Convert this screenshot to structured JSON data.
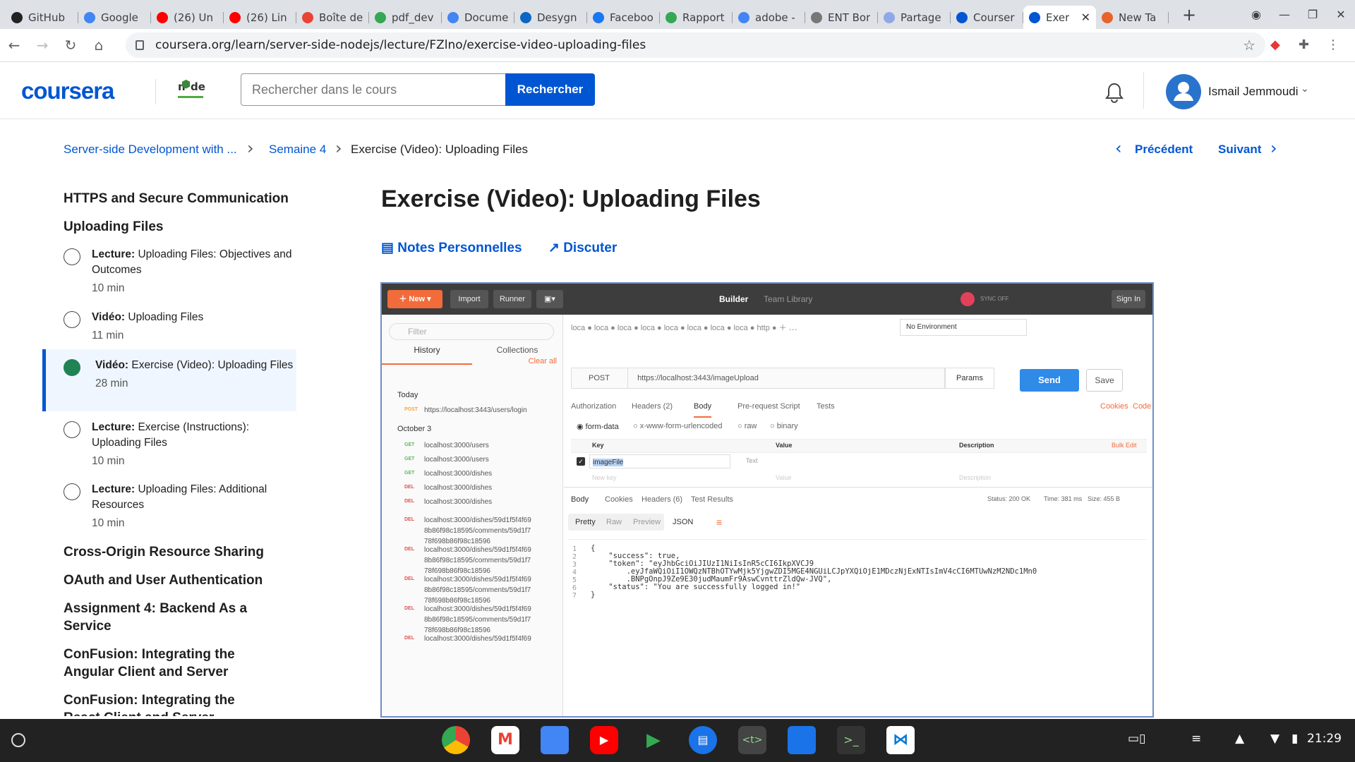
{
  "tabs": [
    {
      "label": "GitHub",
      "color": "#222"
    },
    {
      "label": "Google",
      "color": "#4285f4"
    },
    {
      "label": "(26) Un",
      "color": "#ff0000"
    },
    {
      "label": "(26) Lin",
      "color": "#ff0000"
    },
    {
      "label": "Boîte de",
      "color": "#ea4335"
    },
    {
      "label": "pdf_dev",
      "color": "#34a853"
    },
    {
      "label": "Docume",
      "color": "#4285f4"
    },
    {
      "label": "Desygn",
      "color": "#0a66c2"
    },
    {
      "label": "Faceboo",
      "color": "#1877f2"
    },
    {
      "label": "Rapport",
      "color": "#34a853"
    },
    {
      "label": "adobe -",
      "color": "#4285f4"
    },
    {
      "label": "ENT Bor",
      "color": "#777"
    },
    {
      "label": "Partage",
      "color": "#8fa8e8"
    },
    {
      "label": "Courser",
      "color": "#0056d2"
    },
    {
      "label": "Exer",
      "color": "#0056d2",
      "active": true
    },
    {
      "label": "New Ta",
      "color": "#e8622a"
    }
  ],
  "url": "coursera.org/learn/server-side-nodejs/lecture/FZlno/exercise-video-uploading-files",
  "header": {
    "logo": "coursera",
    "search_placeholder": "Rechercher dans le cours",
    "search_button": "Rechercher",
    "user_name": "Ismail Jemmoudi"
  },
  "breadcrumb": {
    "course": "Server-side Development with ...",
    "week": "Semaine 4",
    "current": "Exercise (Video): Uploading Files",
    "prev": "Précédent",
    "next": "Suivant"
  },
  "sidebar": {
    "sections_top": [
      "HTTPS and Secure Communication",
      "Uploading Files"
    ],
    "items": [
      {
        "type": "Lecture:",
        "title": "Uploading Files: Objectives and Outcomes",
        "dur": "10 min"
      },
      {
        "type": "Vidéo:",
        "title": "Uploading Files",
        "dur": "11 min"
      },
      {
        "type": "Vidéo:",
        "title": "Exercise (Video): Uploading Files",
        "dur": "28 min"
      },
      {
        "type": "Lecture:",
        "title": "Exercise (Instructions): Uploading Files",
        "dur": "10 min"
      },
      {
        "type": "Lecture:",
        "title": "Uploading Files: Additional Resources",
        "dur": "10 min"
      }
    ],
    "sections_bottom": [
      "Cross-Origin Resource Sharing",
      "OAuth and User Authentication",
      "Assignment 4: Backend As a Service",
      "ConFusion: Integrating the Angular Client and Server",
      "ConFusion: Integrating the React Client and Server"
    ]
  },
  "main": {
    "title": "Exercise (Video): Uploading Files",
    "notes": "Notes Personnelles",
    "discuss": "Discuter"
  },
  "video": {
    "buttons": {
      "new": "New",
      "import": "Import",
      "runner": "Runner",
      "builder": "Builder",
      "team": "Team Library",
      "sync": "SYNC OFF",
      "signin": "Sign In"
    },
    "filter": "Filter",
    "history": "History",
    "collections": "Collections",
    "clear": "Clear all",
    "today": "Today",
    "oct": "October 3",
    "requests": [
      {
        "m": "POST",
        "u": "https://localhost:3443/users/login"
      },
      {
        "m": "GET",
        "u": "localhost:3000/users"
      },
      {
        "m": "GET",
        "u": "localhost:3000/users"
      },
      {
        "m": "GET",
        "u": "localhost:3000/dishes"
      },
      {
        "m": "DEL",
        "u": "localhost:3000/dishes"
      },
      {
        "m": "DEL",
        "u": "localhost:3000/dishes"
      },
      {
        "m": "DEL",
        "u": "localhost:3000/dishes/59d1f5f4f69 8b86f98c18595/comments/59d1f7 78f698b86f98c18596"
      },
      {
        "m": "DEL",
        "u": "localhost:3000/dishes/59d1f5f4f69 8b86f98c18595/comments/59d1f7 78f698b86f98c18596"
      },
      {
        "m": "DEL",
        "u": "localhost:3000/dishes/59d1f5f4f69 8b86f98c18595/comments/59d1f7 78f698b86f98c18596"
      },
      {
        "m": "DEL",
        "u": "localhost:3000/dishes/59d1f5f4f69 8b86f98c18595/comments/59d1f7 78f698b86f98c18596"
      },
      {
        "m": "DEL",
        "u": "localhost:3000/dishes/59d1f5f4f69"
      }
    ],
    "env": "No Environment",
    "method": "POST",
    "req_url": "https://localhost:3443/imageUpload",
    "params": "Params",
    "send": "Send",
    "save": "Save",
    "req_tabs": [
      "Authorization",
      "Headers (2)",
      "Body",
      "Pre-request Script",
      "Tests"
    ],
    "cookies": "Cookies",
    "code": "Code",
    "body_types": [
      "form-data",
      "x-www-form-urlencoded",
      "raw",
      "binary"
    ],
    "kv": {
      "key": "Key",
      "value": "Value",
      "desc": "Description",
      "bulk": "Bulk Edit",
      "row_key": "imageFile",
      "row_type": "Text",
      "new_key": "New key",
      "new_value": "Value",
      "new_desc": "Description"
    },
    "resp_tabs": [
      "Body",
      "Cookies",
      "Headers (6)",
      "Test Results"
    ],
    "status": "Status: 200 OK",
    "time": "Time: 381 ms",
    "size": "Size: 455 B",
    "views": [
      "Pretty",
      "Raw",
      "Preview",
      "JSON"
    ],
    "json_lines": [
      "{",
      "    \"success\": true,",
      "    \"token\": \"eyJhbGciOiJIUzI1NiIsInR5cCI6IkpXVCJ9",
      "        .eyJfaWQiOiI1OWQzNTBhOTYwMjk5YjgwZDI5MGE4NGUiLCJpYXQiOjE1MDczNjExNTIsImV4cCI6MTUwNzM2NDc1Mn0",
      "        .BNPgOnpJ9Ze9E30judMaumFr9AswCvnttrZldQw-JVQ\",",
      "    \"status\": \"You are successfully logged in!\"",
      "}"
    ]
  },
  "taskbar": {
    "time": "21:29"
  }
}
